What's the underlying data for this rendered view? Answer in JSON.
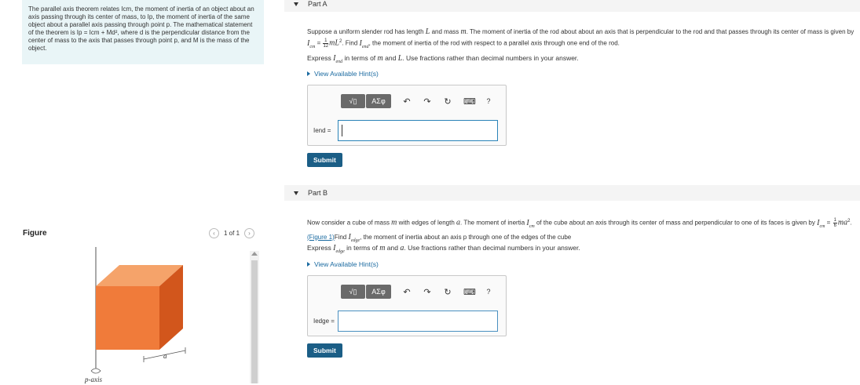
{
  "intro": {
    "text": "The parallel axis theorem relates Icm, the moment of inertia of an object about an axis passing through its center of mass, to Ip, the moment of inertia of the same object about a parallel axis passing through point p. The mathematical statement of the theorem is Ip = Icm + Md², where d is the perpendicular distance from the center of mass to the axis that passes through point p, and M is the mass of the object."
  },
  "figure": {
    "title": "Figure",
    "page_indicator": "1 of 1",
    "axis_label": "p-axis",
    "edge_label": "a",
    "cube_color": "#f07b3a"
  },
  "partA": {
    "label": "Part A",
    "q1": "Suppose a uniform slender rod has length",
    "q2": "and mass",
    "q3": ". The moment of inertia of the rod about about an axis that is perpendicular to the rod and that passes through its center of mass is given by",
    "q4": ". Find",
    "q5": ", the moment of inertia of the rod with respect to a parallel axis through one end of the rod.",
    "express_pre": "Express",
    "express_post": "in terms of",
    "express_end": ". Use fractions rather than decimal numbers in your answer.",
    "hint": "View Available Hint(s)",
    "field_label": "Iend =",
    "submit": "Submit"
  },
  "partB": {
    "label": "Part B",
    "q1": "Now consider a cube of mass",
    "q2": "with edges of length",
    "q3": ". The moment of inertia",
    "q4": "of the cube about an axis through its center of mass and perpendicular to one of its faces is given by",
    "figure_link": "(Figure 1)",
    "q5": "Find",
    "q6": ", the moment of inertia about an axis p through one of the edges of the cube",
    "express_pre": "Express",
    "express_post": "in terms of",
    "express_end": ". Use fractions rather than decimal numbers in your answer.",
    "hint": "View Available Hint(s)",
    "field_label": "Iedge =",
    "submit": "Submit"
  },
  "toolbar": {
    "templates": "√▯",
    "symbols": "ΑΣφ",
    "undo": "↶",
    "redo": "↷",
    "reset": "↻",
    "keyboard": "⌨",
    "help": "?"
  }
}
